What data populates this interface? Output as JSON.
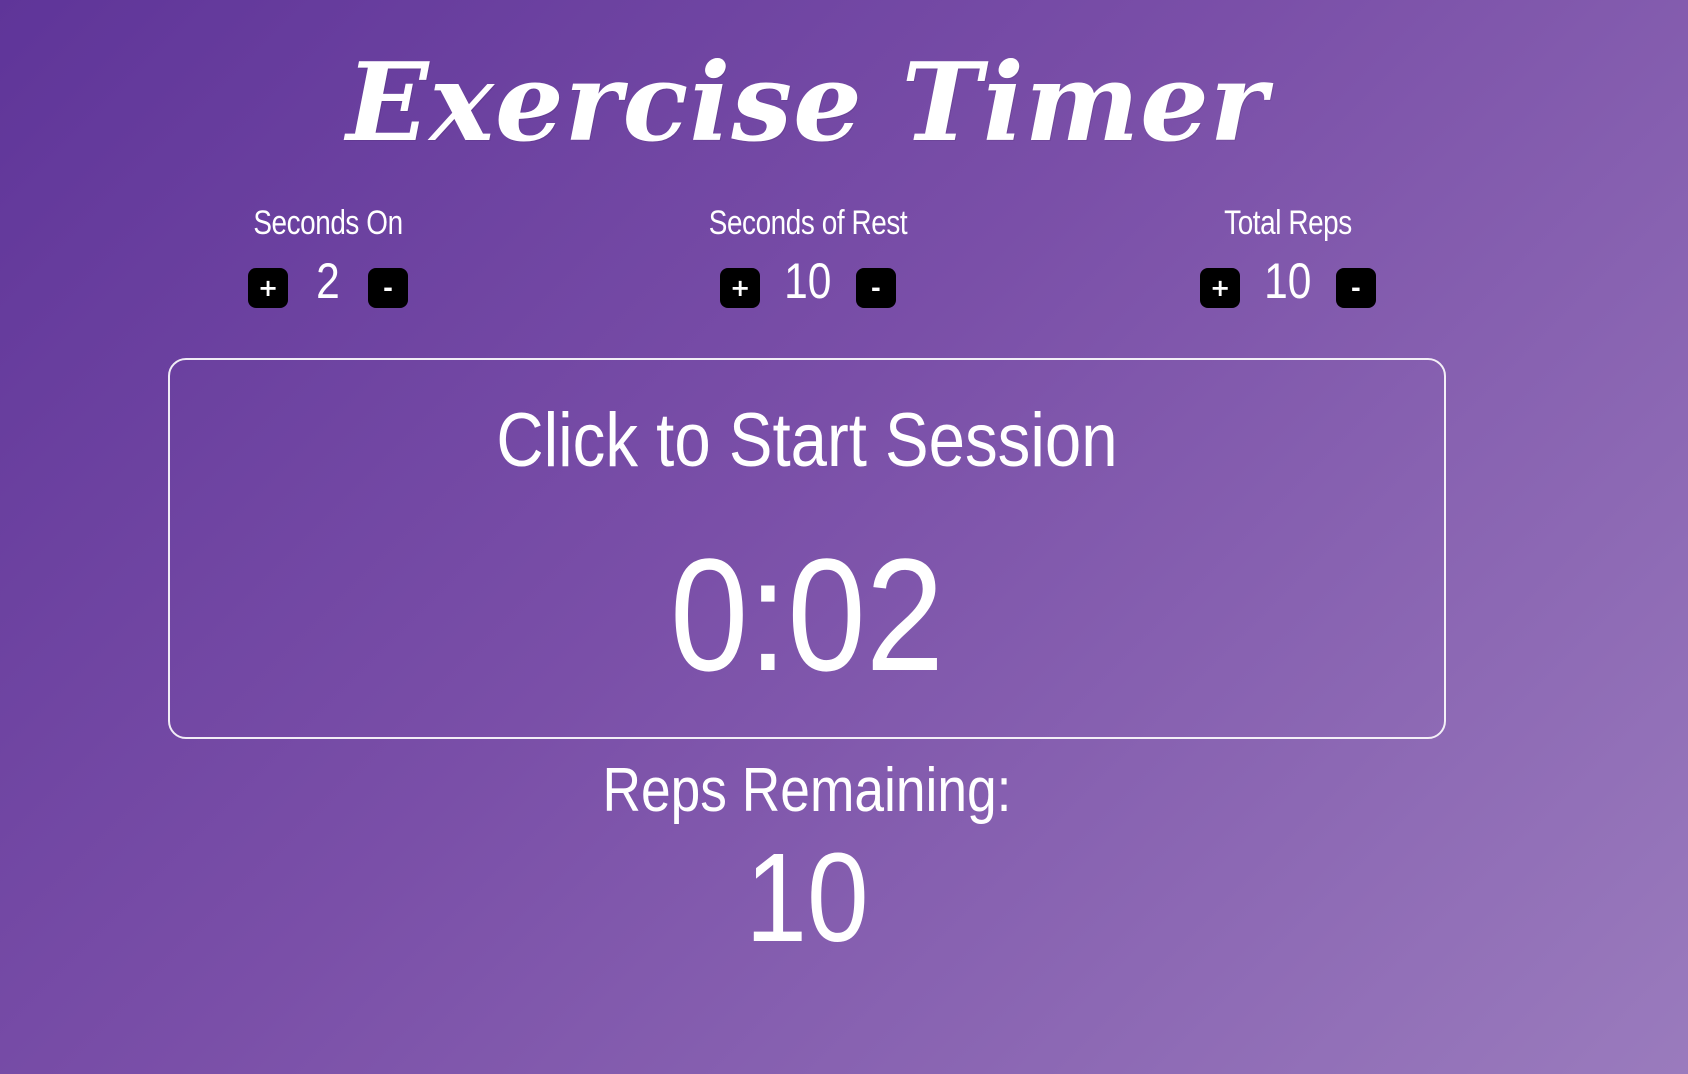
{
  "app": {
    "title": "Exercise Timer"
  },
  "controls": [
    {
      "label": "Seconds On",
      "value": "2",
      "plus_label": "+",
      "minus_label": "-"
    },
    {
      "label": "Seconds of Rest",
      "value": "10",
      "plus_label": "+",
      "minus_label": "-"
    },
    {
      "label": "Total Reps",
      "value": "10",
      "plus_label": "+",
      "minus_label": "-"
    }
  ],
  "session": {
    "prompt": "Click to Start Session",
    "timer": "0:02"
  },
  "reps": {
    "label": "Reps Remaining:",
    "value": "10"
  },
  "colors": {
    "gradient_start": "#5f3599",
    "gradient_end": "#9a7bbd",
    "button_bg": "#000000",
    "text": "#ffffff"
  }
}
